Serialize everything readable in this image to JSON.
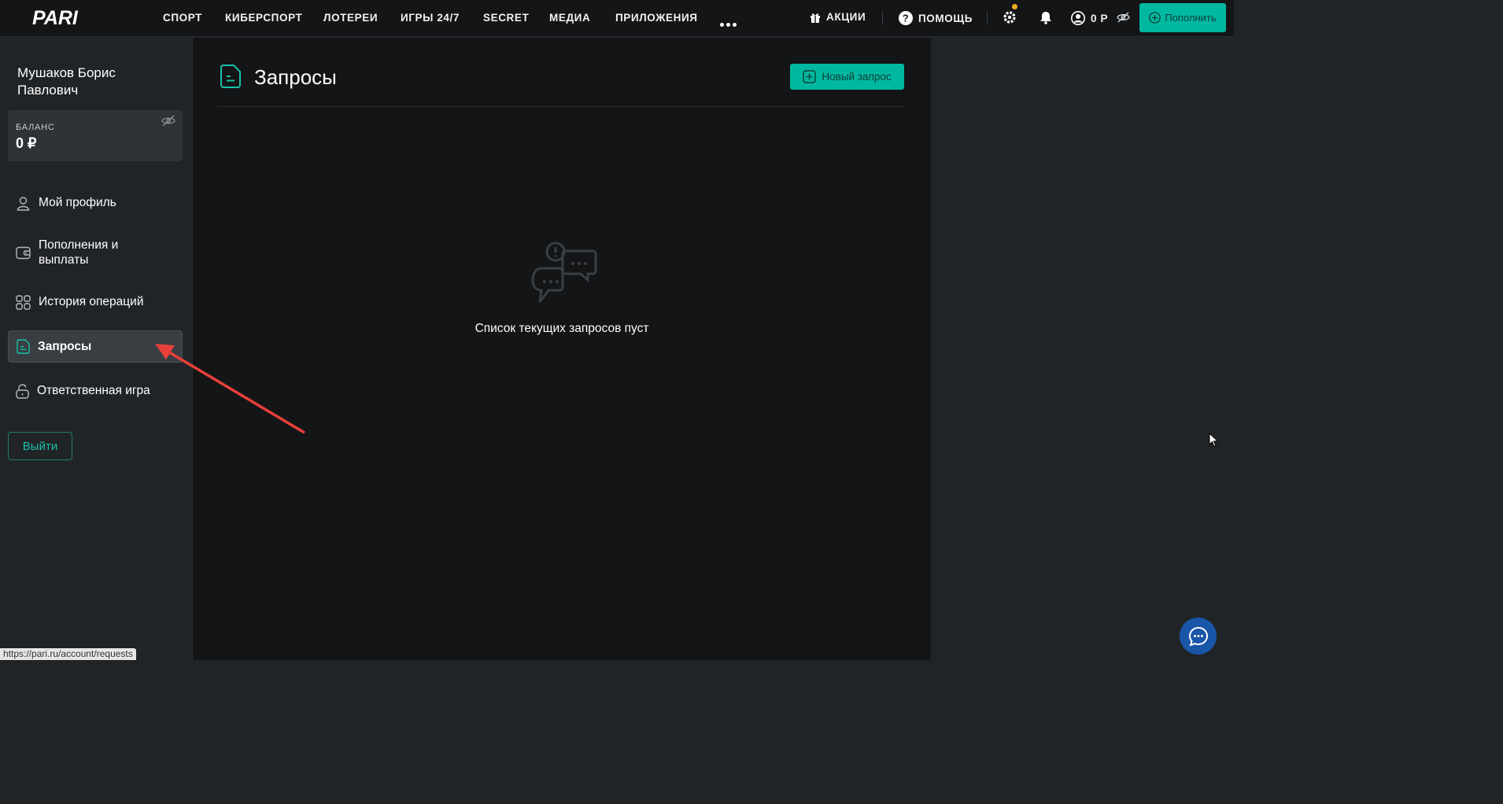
{
  "logo": {
    "text": "PARI"
  },
  "nav": {
    "items": [
      "СПОРТ",
      "КИБЕРСПОРТ",
      "ЛОТЕРЕИ",
      "ИГРЫ 24/7",
      "SECRET",
      "МЕДИА",
      "ПРИЛОЖЕНИЯ"
    ],
    "more_icon": "more-dots-icon"
  },
  "header": {
    "promos_label": "АКЦИИ",
    "help_label": "ПОМОЩЬ",
    "balance_label": "0 Р",
    "topup_label": "Пополнить",
    "settings_badge_color": "#f5a623"
  },
  "sidebar": {
    "user_name": "Мушаков Борис Павлович",
    "balance_title": "БАЛАНС",
    "balance_value": "0 ₽",
    "items": [
      {
        "label": "Мой профиль",
        "icon": "user-icon"
      },
      {
        "label": "Пополнения и выплаты",
        "icon": "wallet-icon"
      },
      {
        "label": "История операций",
        "icon": "grid-icon"
      },
      {
        "label": "Запросы",
        "icon": "document-icon",
        "active": true
      },
      {
        "label": "Ответственная игра",
        "icon": "lock-icon"
      }
    ],
    "logout_label": "Выйти"
  },
  "main": {
    "title": "Запросы",
    "new_request_label": "Новый запрос",
    "empty_text": "Список текущих запросов пуст"
  },
  "status_bar": {
    "url": "https://pari.ru/account/requests"
  },
  "colors": {
    "accent": "#00b8a0",
    "annotation_arrow": "#e8403a"
  }
}
